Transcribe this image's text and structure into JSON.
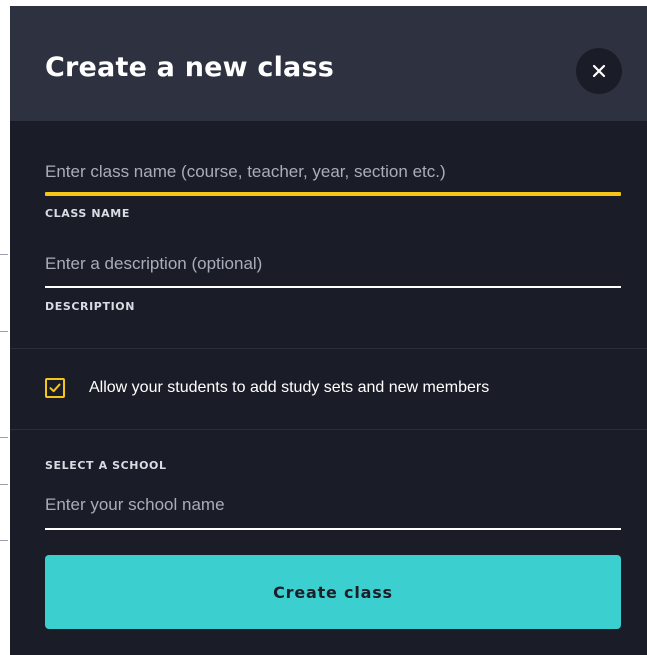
{
  "modal": {
    "title": "Create a new class",
    "close_icon": "close-icon"
  },
  "form": {
    "class_name": {
      "value": "",
      "placeholder": "Enter class name (course, teacher, year, section etc.)",
      "label": "CLASS NAME",
      "focused": true
    },
    "description": {
      "value": "",
      "placeholder": "Enter a description (optional)",
      "label": "DESCRIPTION"
    },
    "allow_members": {
      "checked": true,
      "label": "Allow your students to add study sets and new members"
    },
    "school": {
      "label": "SELECT A SCHOOL",
      "value": "",
      "placeholder": "Enter your school name"
    },
    "submit_label": "Create class"
  },
  "colors": {
    "header_bg": "#2e3240",
    "body_bg": "#1a1d28",
    "accent_yellow": "#f5c518",
    "button_teal": "#3ccfcf"
  }
}
